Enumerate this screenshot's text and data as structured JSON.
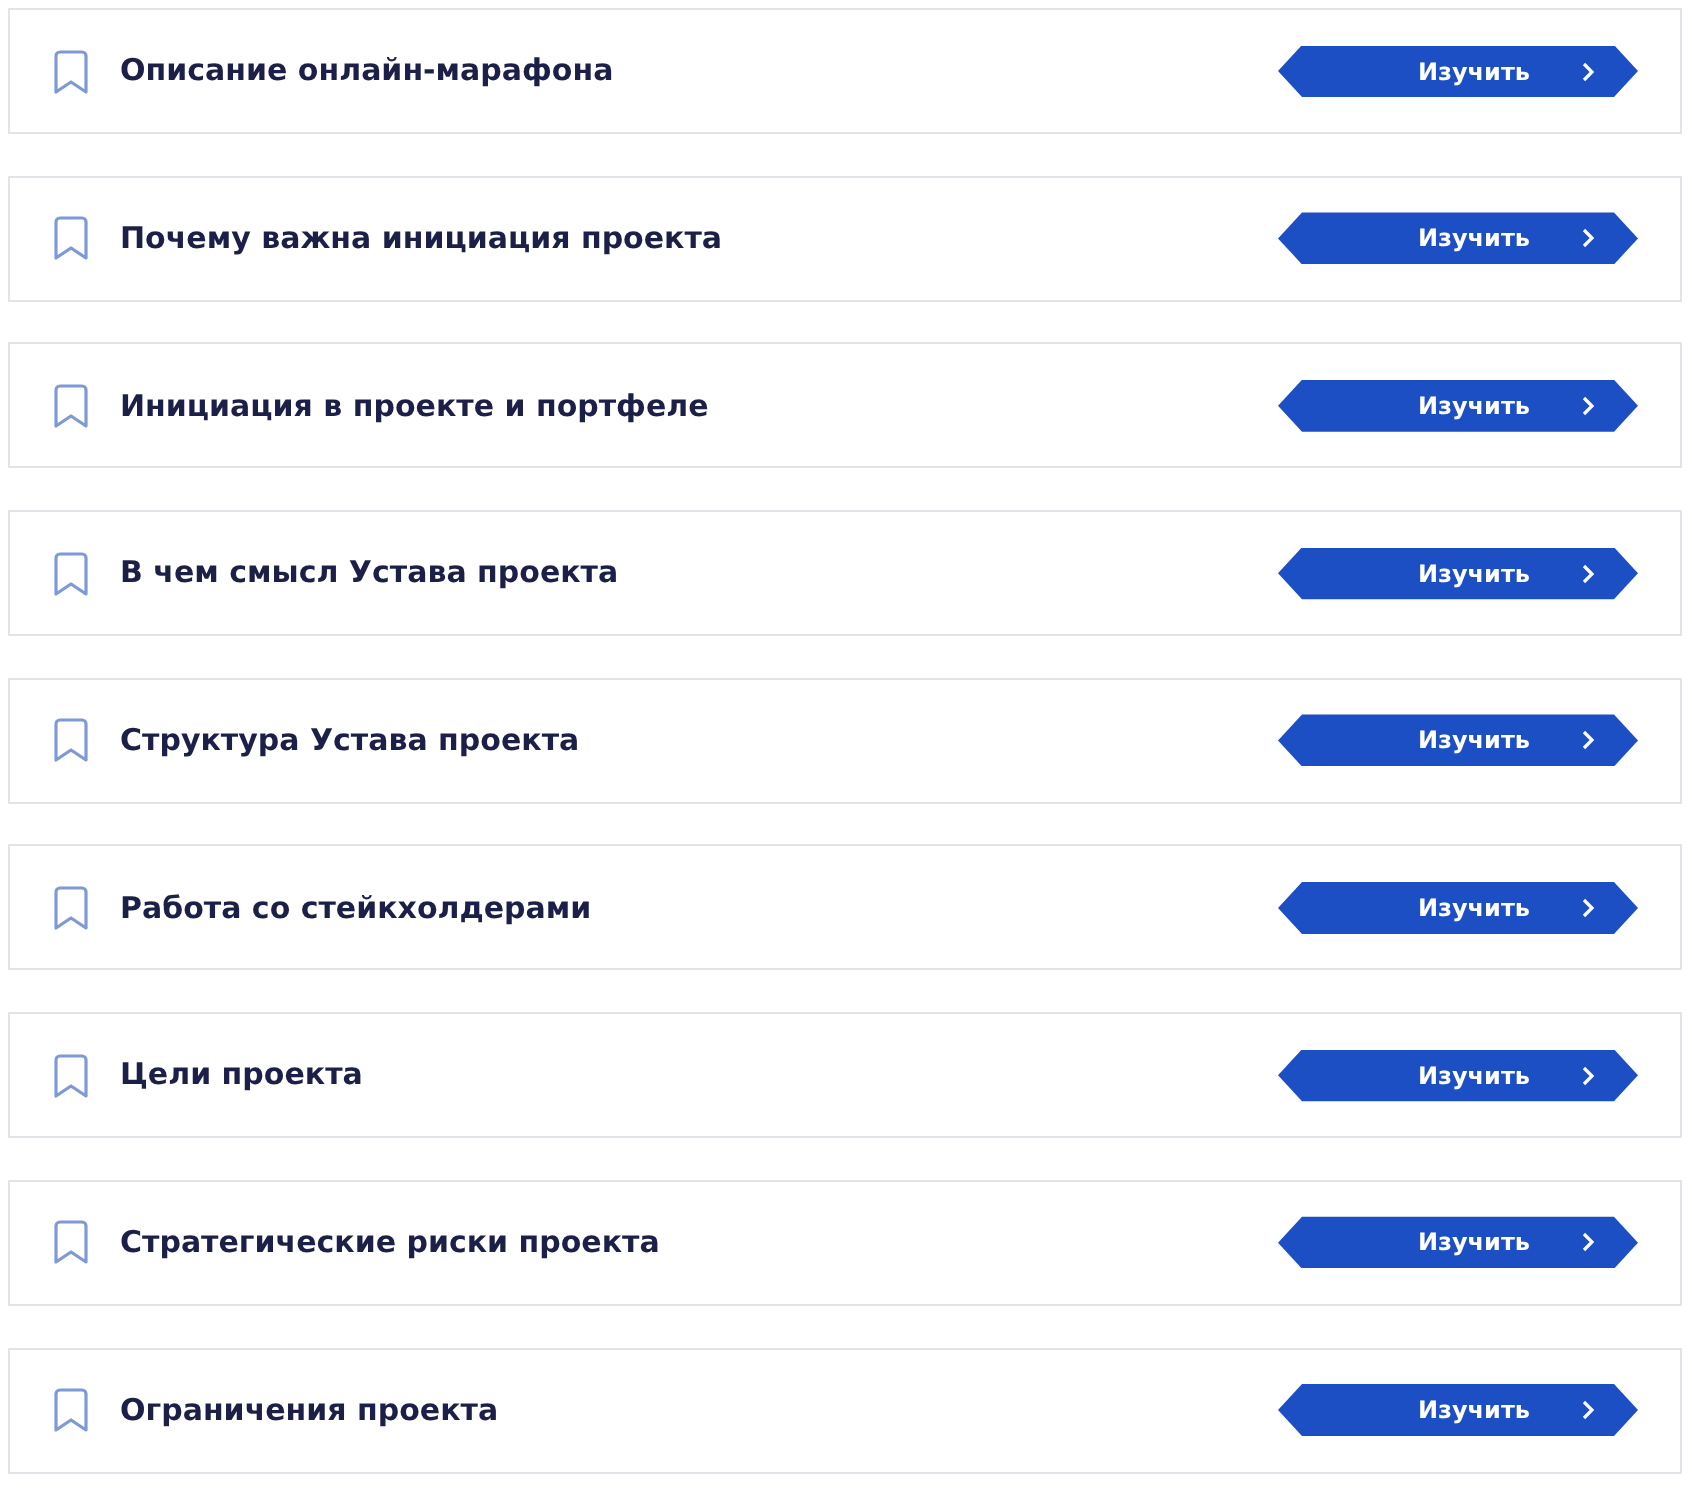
{
  "lessons": [
    {
      "title": "Описание онлайн-марафона",
      "button": "Изучить"
    },
    {
      "title": "Почему важна инициация проекта",
      "button": "Изучить"
    },
    {
      "title": "Инициация в проекте и портфеле",
      "button": "Изучить"
    },
    {
      "title": "В чем смысл Устава проекта",
      "button": "Изучить"
    },
    {
      "title": "Структура Устава проекта",
      "button": "Изучить"
    },
    {
      "title": "Работа со стейкхолдерами",
      "button": "Изучить"
    },
    {
      "title": "Цели проекта",
      "button": "Изучить"
    },
    {
      "title": "Стратегические риски проекта",
      "button": "Изучить"
    },
    {
      "title": "Ограничения проекта",
      "button": "Изучить"
    }
  ]
}
